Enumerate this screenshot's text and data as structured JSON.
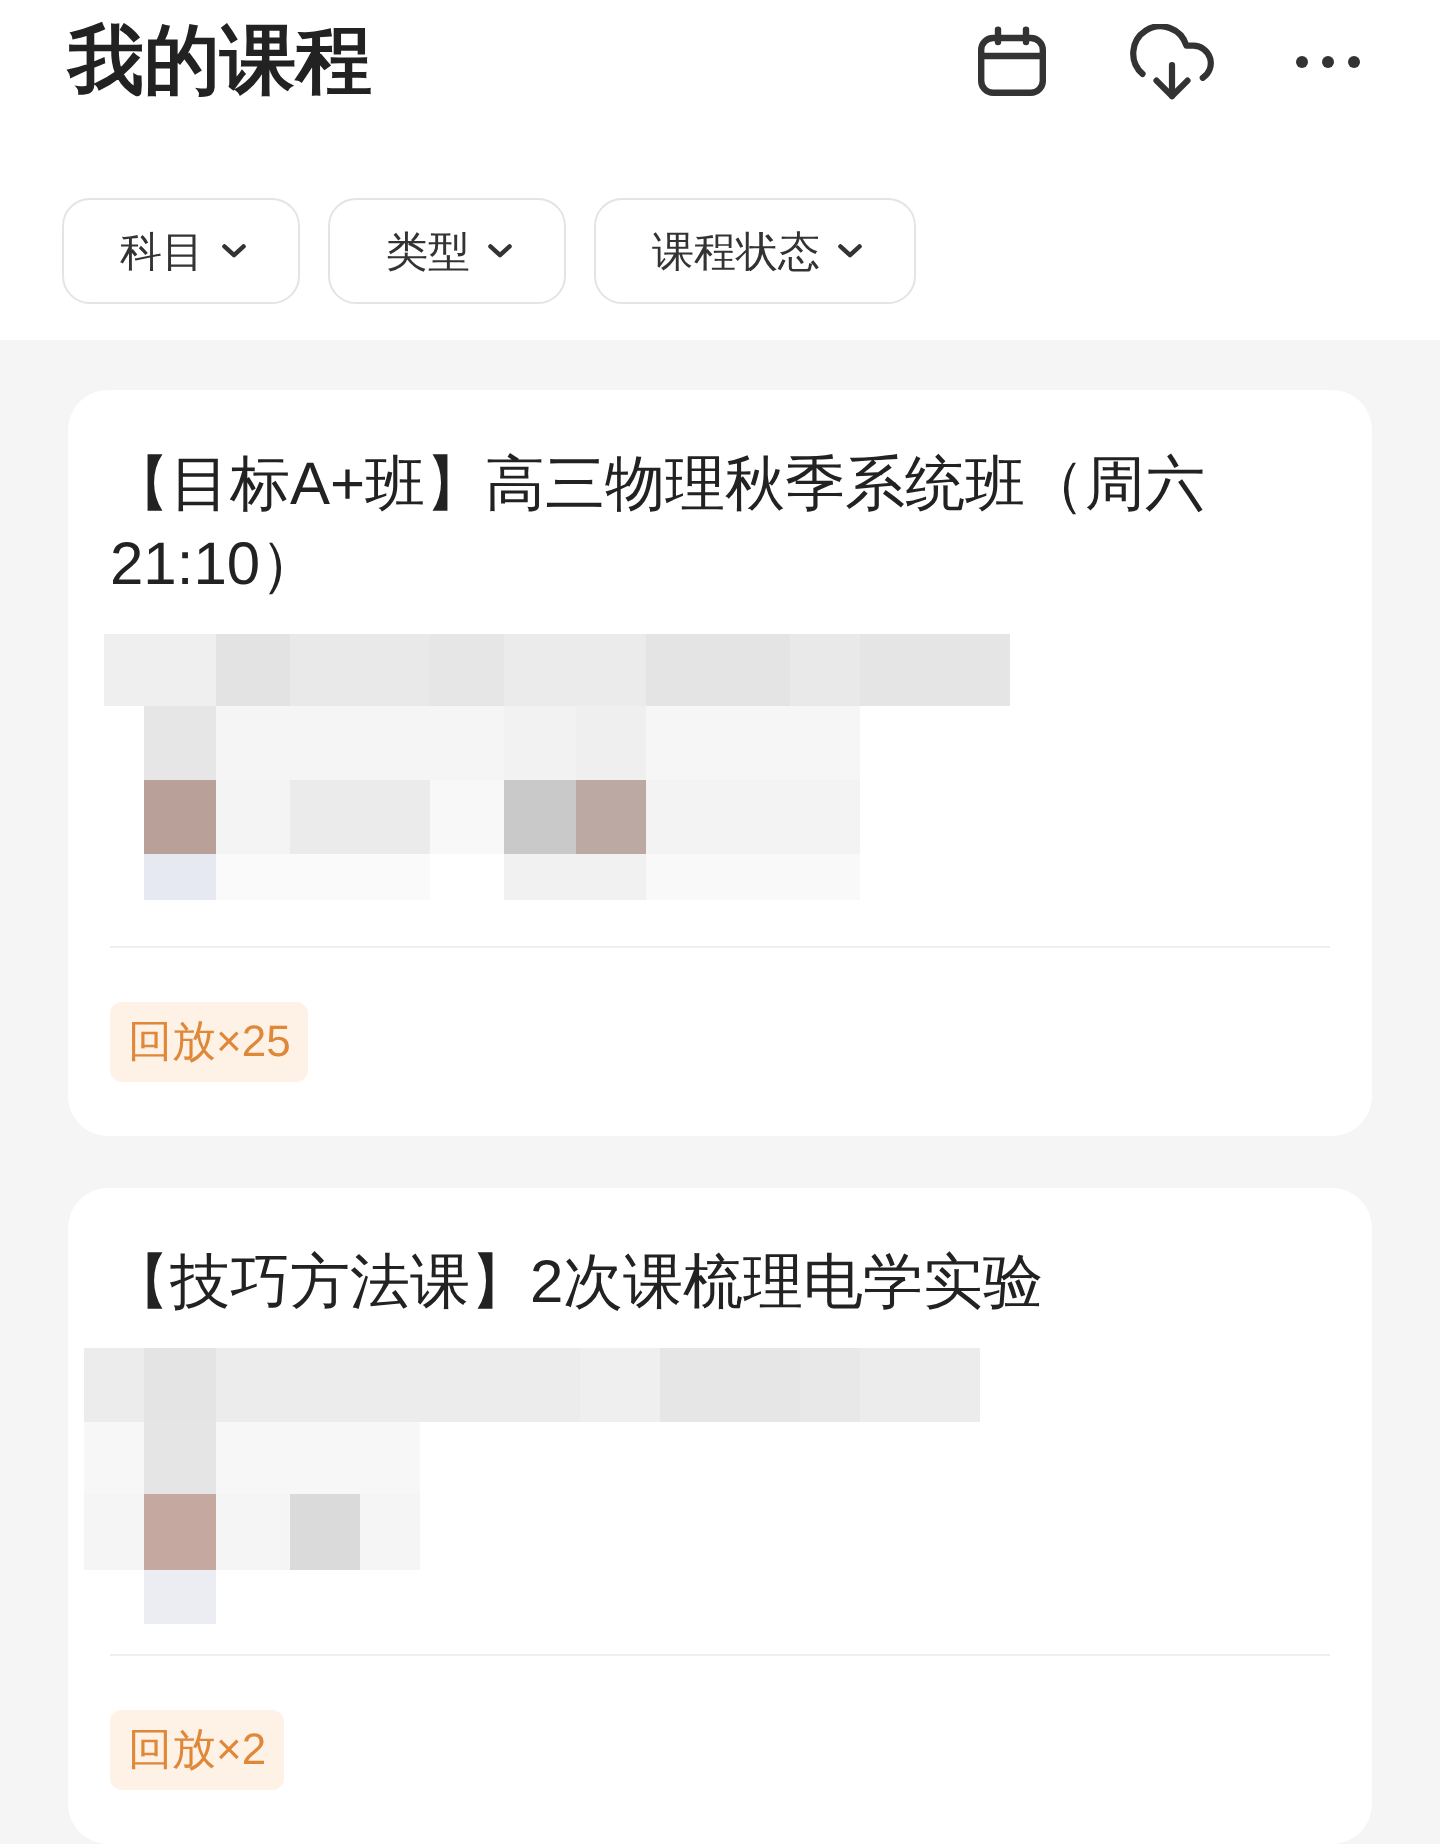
{
  "header": {
    "title": "我的课程"
  },
  "filters": [
    {
      "label": "科目"
    },
    {
      "label": "类型"
    },
    {
      "label": "课程状态"
    }
  ],
  "courses": [
    {
      "title": "【目标A+班】高三物理秋季系统班（周六21:10）",
      "badge": "回放×25"
    },
    {
      "title": "【技巧方法课】2次课梳理电学实验",
      "badge": "回放×2"
    }
  ]
}
